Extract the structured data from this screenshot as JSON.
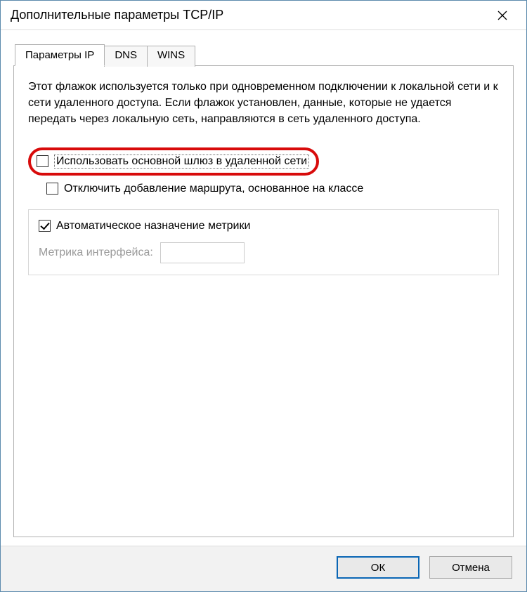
{
  "window": {
    "title": "Дополнительные параметры TCP/IP"
  },
  "tabs": {
    "ip": "Параметры IP",
    "dns": "DNS",
    "wins": "WINS"
  },
  "panel": {
    "description": "Этот флажок используется только при одновременном подключении к локальной сети и к сети удаленного доступа. Если флажок установлен, данные, которые не удается передать через локальную сеть, направляются в сеть удаленного доступа.",
    "use_default_gateway_label": "Использовать основной шлюз в удаленной сети",
    "disable_class_route_label": "Отключить добавление маршрута, основанное на классе",
    "auto_metric_label": "Автоматическое назначение метрики",
    "interface_metric_label": "Метрика интерфейса:"
  },
  "buttons": {
    "ok": "ОК",
    "cancel": "Отмена"
  }
}
